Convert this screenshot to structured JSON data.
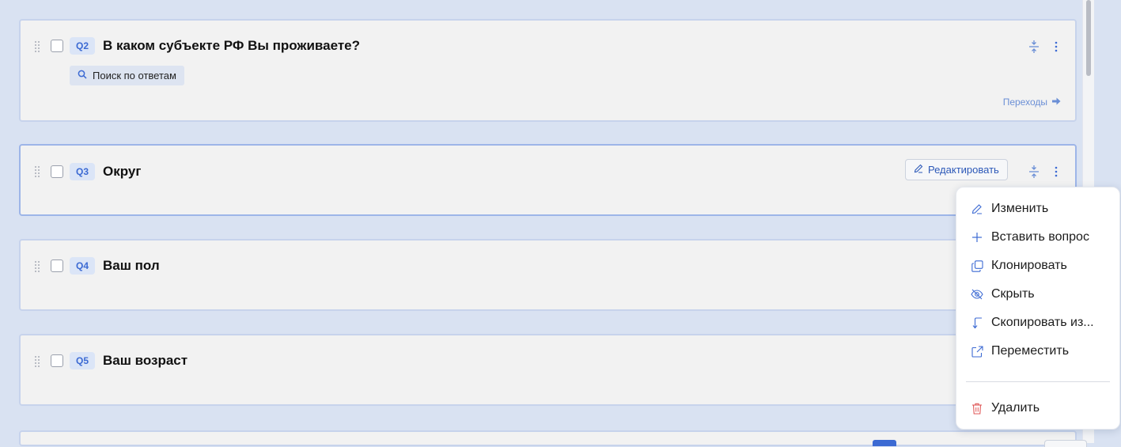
{
  "colors": {
    "background": "#d9e2f2",
    "card": "#f2f2f2",
    "accent": "#3c6ad3",
    "danger": "#e05a5a"
  },
  "questions": [
    {
      "id": "Q2",
      "title": "В каком субъекте РФ Вы проживаете?",
      "search_chip": "Поиск по ответам",
      "transitions_label": "Переходы"
    },
    {
      "id": "Q3",
      "title": "Округ",
      "edit_label": "Редактировать"
    },
    {
      "id": "Q4",
      "title": "Ваш пол"
    },
    {
      "id": "Q5",
      "title": "Ваш возраст"
    }
  ],
  "context_menu": {
    "items": [
      {
        "label": "Изменить",
        "icon": "pencil-icon"
      },
      {
        "label": "Вставить вопрос",
        "icon": "plus-icon"
      },
      {
        "label": "Клонировать",
        "icon": "clone-icon"
      },
      {
        "label": "Скрыть",
        "icon": "eye-off-icon"
      },
      {
        "label": "Скопировать из...",
        "icon": "copy-from-icon"
      },
      {
        "label": "Переместить",
        "icon": "external-move-icon"
      }
    ],
    "delete": {
      "label": "Удалить",
      "icon": "trash-icon"
    }
  }
}
